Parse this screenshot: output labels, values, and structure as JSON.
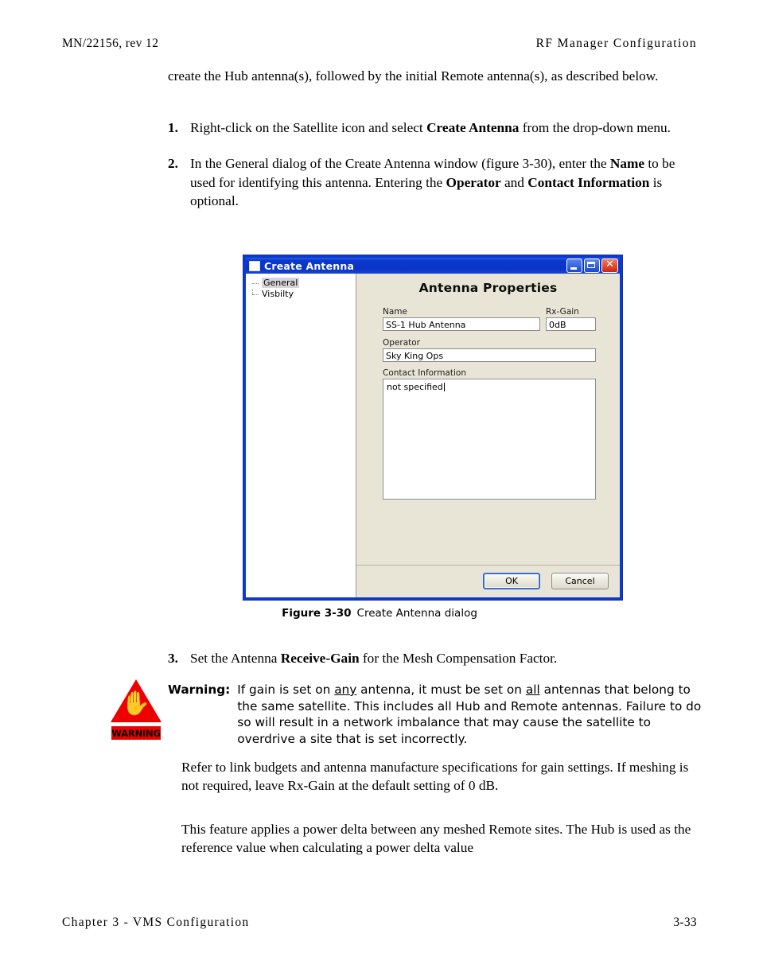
{
  "header": {
    "left": "MN/22156, rev 12",
    "right": "RF Manager Configuration"
  },
  "intro": "create the Hub antenna(s), followed by the initial Remote antenna(s), as described below.",
  "steps": [
    {
      "num": "1.",
      "part1": "Right-click on the Satellite icon and select ",
      "bold1": "Create Antenna",
      "part2": " from the drop-down menu.",
      "bold2": "",
      "part3": "",
      "bold3": "",
      "part4": ""
    },
    {
      "num": "2.",
      "part1": "In the General dialog of the Create Antenna window (figure 3-30), enter the ",
      "bold1": "Name",
      "part2": " to be used for identifying this antenna. Entering the ",
      "bold2": "Operator",
      "part3": " and ",
      "bold3": "Contact Information",
      "part4": " is optional."
    }
  ],
  "dialog": {
    "title": "Create Antenna",
    "window_buttons": {
      "minimize": "minimize-button",
      "maximize": "maximize-button",
      "close": "close-button",
      "close_glyph": "✕"
    },
    "tree": [
      {
        "label": "General",
        "selected": true
      },
      {
        "label": "Visbilty",
        "selected": false
      }
    ],
    "panel_heading": "Antenna Properties",
    "fields": {
      "name_label": "Name",
      "name_value": "SS-1 Hub Antenna",
      "rxgain_label": "Rx-Gain",
      "rxgain_value": "0dB",
      "operator_label": "Operator",
      "operator_value": "Sky King Ops",
      "contact_label": "Contact Information",
      "contact_value": "not specified"
    },
    "buttons": {
      "ok": "OK",
      "cancel": "Cancel"
    },
    "colors": {
      "titlebar": "#0a34c6",
      "panel": "#e9e5d6",
      "close_button": "#cf2410",
      "border": "#0a3bd0"
    }
  },
  "figure_caption": {
    "number": "Figure 3-30",
    "text": "Create Antenna dialog"
  },
  "step3": {
    "num": "3.",
    "part1": "Set the Antenna ",
    "bold1": "Receive-Gain",
    "part2": " for the Mesh Compensation Factor."
  },
  "warning": {
    "icon_band": "WARNING",
    "icon_glyph": "✋",
    "icon_color": "#ef0000",
    "label": "Warning:",
    "t1": "If gain is set on ",
    "u1": "any",
    "t2": " antenna, it must be set on ",
    "u2": "all",
    "t3": " antennas that belong to the same satellite. This includes all Hub and Remote antennas. Failure to do so will result in a network imbalance that may cause the satellite to overdrive a site that is set incorrectly."
  },
  "tail": {
    "p1": "Refer to link budgets and antenna manufacture specifications for gain settings. If meshing is not required, leave Rx-Gain at the default setting of 0 dB.",
    "p2": "This feature applies a power delta between any meshed Remote sites. The Hub is used as the reference value when calculating a power delta value"
  },
  "footer": {
    "left": "Chapter 3 - VMS Configuration",
    "pageno": "3-33"
  }
}
